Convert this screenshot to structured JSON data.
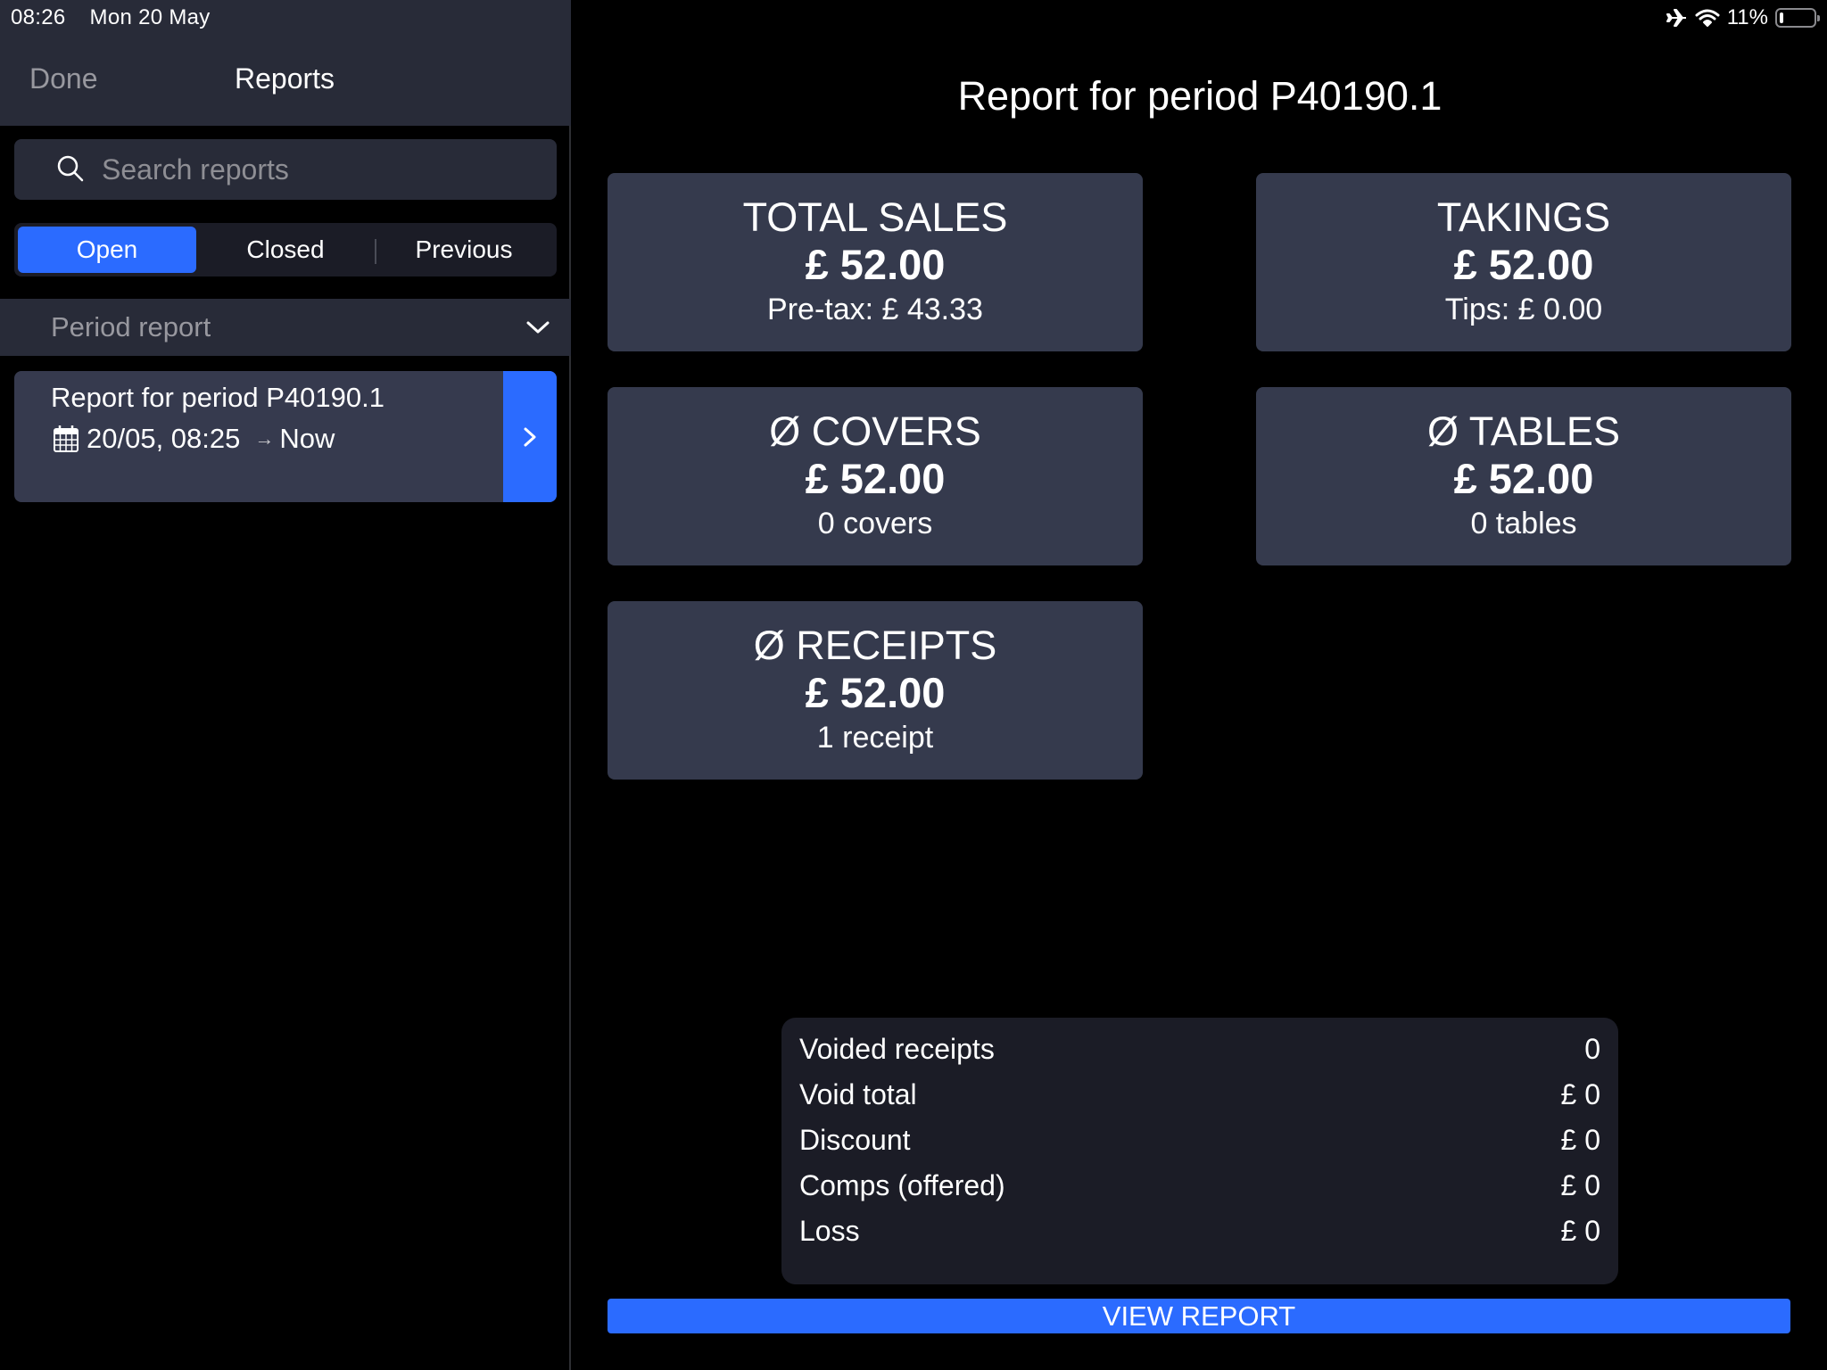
{
  "status_bar": {
    "time": "08:26",
    "date": "Mon 20 May",
    "battery_percent_label": "11%",
    "battery_level": 0.11,
    "icons": [
      "airplane-icon",
      "wifi-icon",
      "battery-icon"
    ]
  },
  "sidebar": {
    "done_label": "Done",
    "title": "Reports",
    "search": {
      "placeholder": "Search reports",
      "value": ""
    },
    "segments": [
      {
        "label": "Open",
        "active": true
      },
      {
        "label": "Closed",
        "active": false
      },
      {
        "label": "Previous",
        "active": false
      }
    ],
    "section_header": "Period report",
    "reports": [
      {
        "title": "Report for period P40190.1",
        "start": "20/05, 08:25",
        "arrow": "→",
        "end": "Now"
      }
    ]
  },
  "main": {
    "title": "Report for period P40190.1",
    "cards": [
      {
        "title": "TOTAL SALES",
        "value": "£ 52.00",
        "sub": "Pre-tax: £ 43.33"
      },
      {
        "title": "TAKINGS",
        "value": "£ 52.00",
        "sub": "Tips: £ 0.00"
      },
      {
        "title": "Ø COVERS",
        "value": "£ 52.00",
        "sub": "0 covers"
      },
      {
        "title": "Ø TABLES",
        "value": "£ 52.00",
        "sub": "0 tables"
      },
      {
        "title": "Ø RECEIPTS",
        "value": "£ 52.00",
        "sub": "1 receipt"
      }
    ],
    "summary": [
      {
        "label": "Voided receipts",
        "value": "0"
      },
      {
        "label": "Void total",
        "value": "£ 0"
      },
      {
        "label": "Discount",
        "value": "£ 0"
      },
      {
        "label": "Comps (offered)",
        "value": "£ 0"
      },
      {
        "label": "Loss",
        "value": "£ 0"
      }
    ],
    "view_report_label": "VIEW REPORT"
  },
  "colors": {
    "accent": "#2b6bff",
    "card_bg": "#353a4d",
    "panel_bg": "#282b38",
    "summary_bg": "#1b1c26",
    "muted_text": "#98989f"
  }
}
